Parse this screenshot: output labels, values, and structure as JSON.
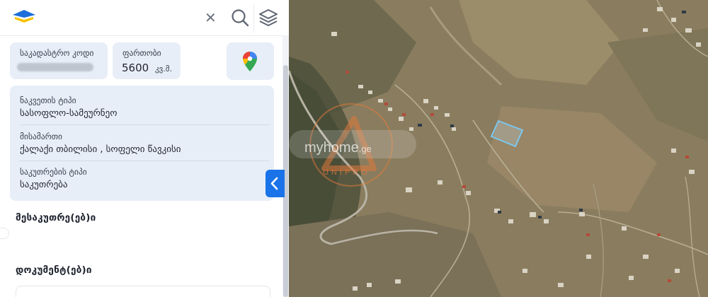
{
  "header": {
    "close_icon": "close-icon",
    "search_icon": "search-icon",
    "layers_icon": "layers-icon"
  },
  "property": {
    "cadastral_label": "საკადასტრო კოდი",
    "area_label": "ფართობი",
    "area_value": "5600",
    "area_unit": "კვ.მ.",
    "maps_icon": "google-maps-pin-icon",
    "parcel_type_label": "ნაკვეთის ტიპი",
    "parcel_type_value": "სასოფლო-სამეურნეო",
    "address_label": "მისამართი",
    "address_value": "ქალაქი თბილისი , სოფელი წავკისი",
    "ownership_type_label": "საკუთრების ტიპი",
    "ownership_type_value": "საკუთრება"
  },
  "sections": {
    "owners_title": "მესაკუთრე(ებ)ი",
    "documents_title": "დოკუმენტ(ებ)ი"
  },
  "watermark": {
    "brand": "myhome",
    "suffix": ".ge",
    "sub": "UNIPRO"
  },
  "colors": {
    "accent": "#1a73e8",
    "card_bg": "#e8eef7",
    "parcel_outline": "#7cc8f0"
  }
}
